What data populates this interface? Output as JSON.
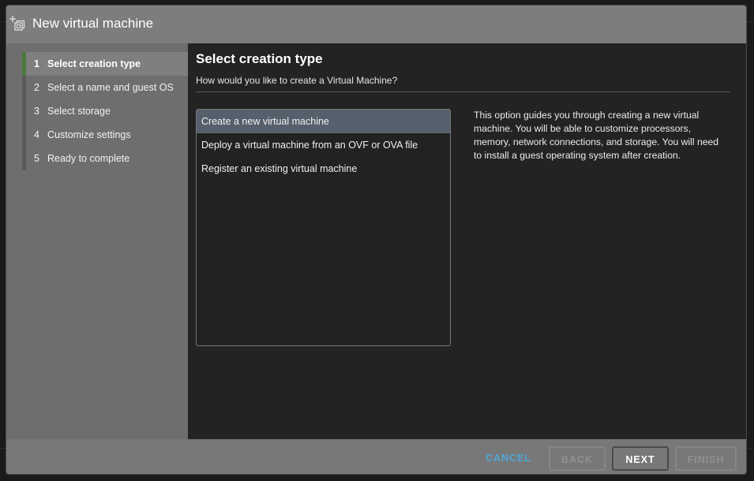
{
  "dialog": {
    "title": "New virtual machine",
    "icon": "add-vm-icon"
  },
  "sidebar": {
    "steps": [
      {
        "num": "1",
        "label": "Select creation type"
      },
      {
        "num": "2",
        "label": "Select a name and guest OS"
      },
      {
        "num": "3",
        "label": "Select storage"
      },
      {
        "num": "4",
        "label": "Customize settings"
      },
      {
        "num": "5",
        "label": "Ready to complete"
      }
    ]
  },
  "main": {
    "title": "Select creation type",
    "subtitle": "How would you like to create a Virtual Machine?",
    "options": [
      "Create a new virtual machine",
      "Deploy a virtual machine from an OVF or OVA file",
      "Register an existing virtual machine"
    ],
    "selected_option": "Create a new virtual machine",
    "description": "This option guides you through creating a new virtual machine. You will be able to customize processors, memory, network connections, and storage. You will need to install a guest operating system after creation."
  },
  "footer": {
    "cancel": "CANCEL",
    "back": "BACK",
    "next": "NEXT",
    "finish": "FINISH"
  },
  "colors": {
    "accent_active_step": "#4a7a3c",
    "cancel_link": "#4fa8d8",
    "selected_option": "#56606c"
  }
}
